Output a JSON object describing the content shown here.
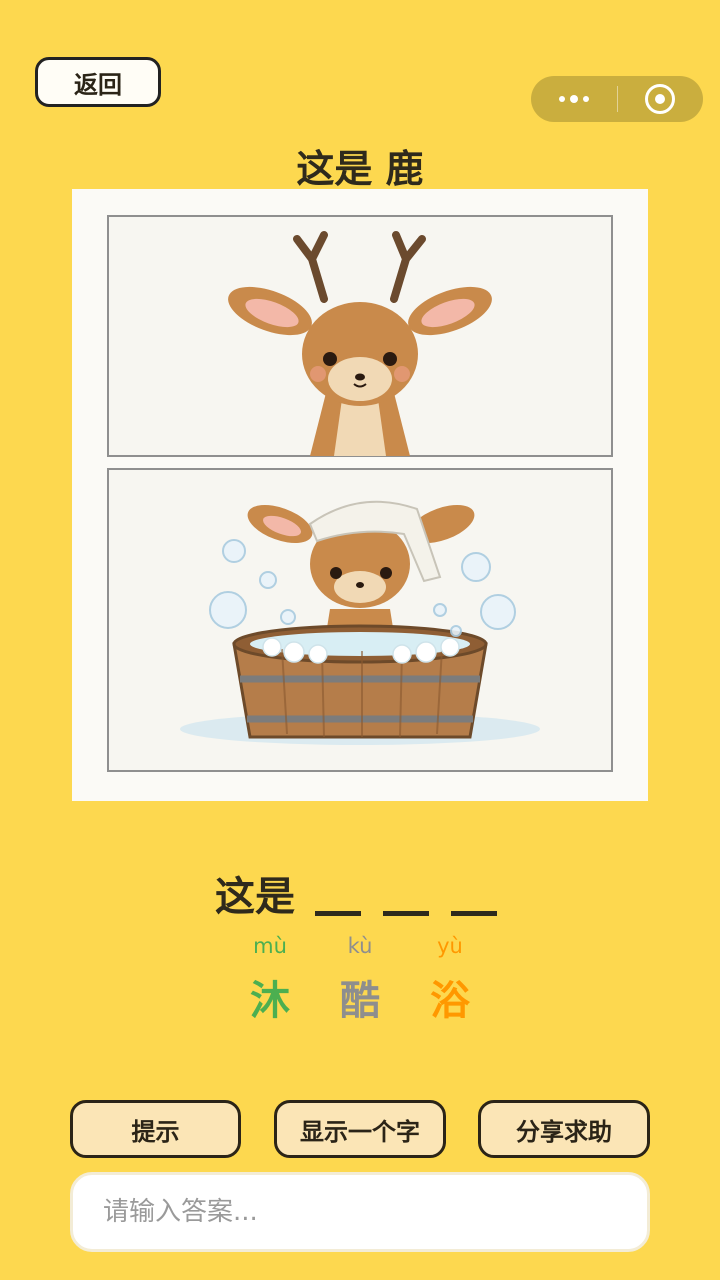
{
  "header": {
    "back_label": "返回",
    "title": "这是 鹿"
  },
  "puzzle": {
    "prefix": "这是",
    "blank_count": 3,
    "options": [
      {
        "pinyin": "mù",
        "char": "沐",
        "color": "#4CAF50"
      },
      {
        "pinyin": "kù",
        "char": "酷",
        "color": "#8E8E8E"
      },
      {
        "pinyin": "yù",
        "char": "浴",
        "color": "#FF9800"
      }
    ]
  },
  "buttons": {
    "hint": "提示",
    "reveal": "显示一个字",
    "share": "分享求助"
  },
  "answer": {
    "placeholder": "请输入答案...",
    "value": ""
  },
  "colors": {
    "background": "#FDD84F",
    "button_fill": "#FBE5B6"
  },
  "icons": [
    "more-dots-icon",
    "close-target-icon"
  ]
}
